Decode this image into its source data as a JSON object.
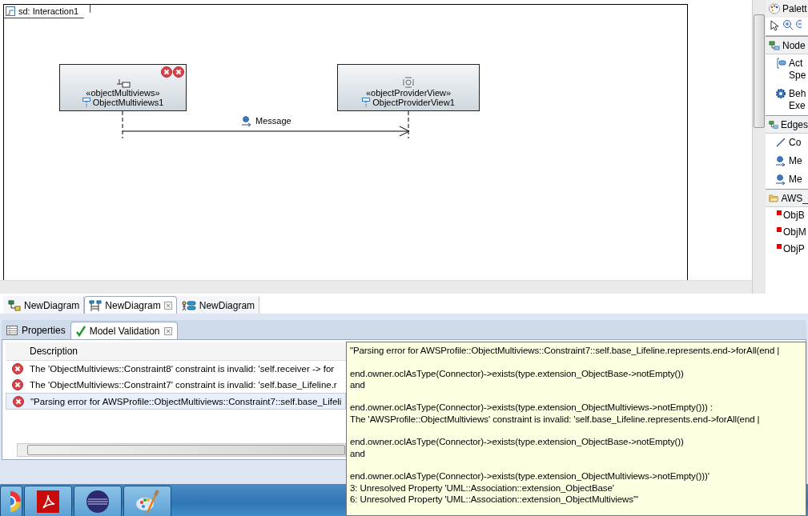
{
  "diagram": {
    "frame_label": "sd: Interaction1",
    "lifelines": [
      {
        "stereotype": "«objectMultiviews»",
        "name": "ObjectMultiviews1",
        "error_markers": [
          {
            "kind": "error"
          },
          {
            "kind": "error"
          }
        ]
      },
      {
        "stereotype": "«objectProviderView»",
        "name": "ObjectProviderView1"
      }
    ],
    "message": {
      "label": "Message"
    }
  },
  "palette": {
    "title": "Palett",
    "sections": [
      {
        "label": "Node",
        "entries": [
          {
            "kind": "action",
            "lines": [
              "Act",
              "Spe"
            ]
          },
          {
            "kind": "behavior",
            "lines": [
              "Beh",
              "Exe"
            ]
          }
        ]
      },
      {
        "label": "Edges",
        "entries": [
          {
            "kind": "connector",
            "lines": [
              "Co"
            ]
          },
          {
            "kind": "message",
            "lines": [
              "Me"
            ]
          },
          {
            "kind": "message",
            "lines": [
              "Me"
            ]
          }
        ]
      },
      {
        "label": "AWS_",
        "entries": [
          {
            "kind": "stereotype",
            "lines": [
              "ObjB"
            ]
          },
          {
            "kind": "stereotype",
            "lines": [
              "ObjM"
            ]
          },
          {
            "kind": "stereotype",
            "lines": [
              "ObjP"
            ]
          }
        ]
      }
    ]
  },
  "editor_tabs": [
    {
      "label": "NewDiagram",
      "selected": false,
      "closable": false
    },
    {
      "label": "NewDiagram",
      "selected": true,
      "closable": true
    },
    {
      "label": "NewDiagram",
      "selected": false,
      "closable": false
    }
  ],
  "panel_tabs": [
    {
      "label": "Properties",
      "selected": false,
      "closable": false
    },
    {
      "label": "Model Validation",
      "selected": true,
      "closable": true
    }
  ],
  "table": {
    "columns": [
      "Description"
    ],
    "rows": [
      {
        "kind": "error",
        "selected": false,
        "description": "The 'ObjectMultiviews::Constraint8' constraint is invalid: 'self.receiver -> for"
      },
      {
        "kind": "error",
        "selected": false,
        "description": "The 'ObjectMultiviews::Constraint7' constraint is invalid: 'self.base_Lifeline.r"
      },
      {
        "kind": "error",
        "selected": true,
        "description": "\"Parsing error for AWSProfile::ObjectMultiviews::Constraint7::self.base_Lifeli"
      }
    ]
  },
  "tooltip": {
    "paragraphs": [
      [
        "\"Parsing error for AWSProfile::ObjectMultiviews::Constraint7::self.base_Lifeline.represents.end->forAll(end |"
      ],
      [
        "end.owner.oclAsType(Connector)->exists(type.extension_ObjectBase->notEmpty())",
        "and"
      ],
      [
        "end.owner.oclAsType(Connector)->exists(type.extension_ObjectMultiviews->notEmpty())) :",
        " The 'AWSProfile::ObjectMultiviews' constraint is invalid: 'self.base_Lifeline.represents.end->forAll(end |"
      ],
      [
        "end.owner.oclAsType(Connector)->exists(type.extension_ObjectBase->notEmpty())",
        "and"
      ],
      [
        "end.owner.oclAsType(Connector)->exists(type.extension_ObjectMultiviews->notEmpty()))'",
        "3: Unresolved Property 'UML::Association::extension_ObjectBase'",
        "6: Unresolved Property 'UML::Association::extension_ObjectMultiviews'\""
      ]
    ]
  }
}
